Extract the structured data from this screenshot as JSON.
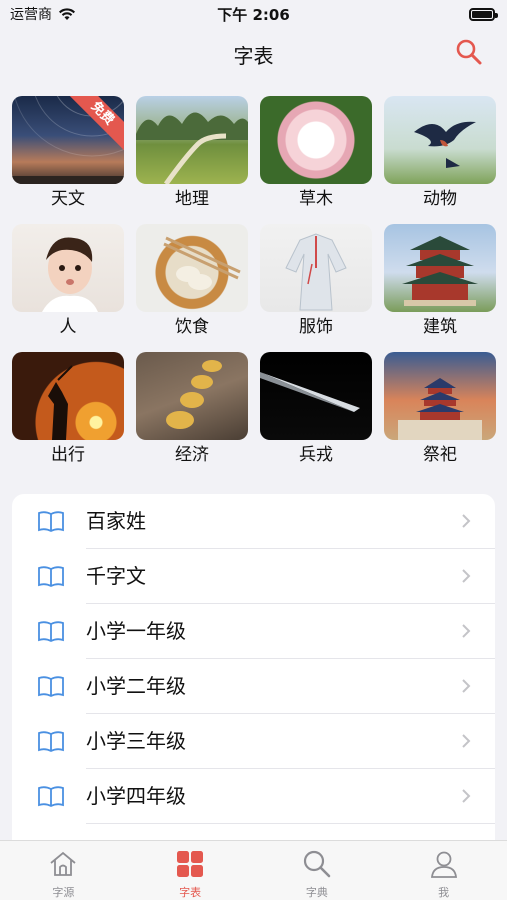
{
  "status": {
    "carrier": "运营商",
    "time": "下午 2:06"
  },
  "nav": {
    "title": "字表"
  },
  "colors": {
    "accent": "#e4584f",
    "background": "#f2f2f6",
    "icon_blue": "#4a90e2"
  },
  "categories": [
    {
      "label": "天文",
      "icon": "astronomy-image",
      "badge": "免费"
    },
    {
      "label": "地理",
      "icon": "geography-image"
    },
    {
      "label": "草木",
      "icon": "plants-image"
    },
    {
      "label": "动物",
      "icon": "animals-image"
    },
    {
      "label": "人",
      "icon": "people-image"
    },
    {
      "label": "饮食",
      "icon": "food-image"
    },
    {
      "label": "服饰",
      "icon": "clothing-image"
    },
    {
      "label": "建筑",
      "icon": "architecture-image"
    },
    {
      "label": "出行",
      "icon": "travel-image"
    },
    {
      "label": "经济",
      "icon": "economy-image"
    },
    {
      "label": "兵戎",
      "icon": "military-image"
    },
    {
      "label": "祭祀",
      "icon": "sacrifice-image"
    }
  ],
  "list": [
    {
      "label": "百家姓"
    },
    {
      "label": "千字文"
    },
    {
      "label": "小学一年级"
    },
    {
      "label": "小学二年级"
    },
    {
      "label": "小学三年级"
    },
    {
      "label": "小学四年级"
    }
  ],
  "tabs": [
    {
      "label": "字源",
      "icon": "house-icon"
    },
    {
      "label": "字表",
      "icon": "grid-icon",
      "active": true
    },
    {
      "label": "字典",
      "icon": "search-icon"
    },
    {
      "label": "我",
      "icon": "person-icon"
    }
  ]
}
